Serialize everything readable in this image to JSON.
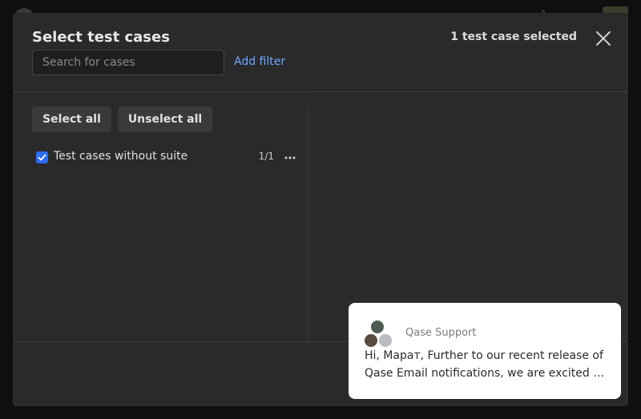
{
  "modal": {
    "title": "Select test cases",
    "selected_count": "1 test case selected",
    "search": {
      "placeholder": "Search for cases",
      "value": ""
    },
    "add_filter_label": "Add filter",
    "select_all_label": "Select all",
    "unselect_all_label": "Unselect all",
    "suites": [
      {
        "label": "Test cases without suite",
        "count": "1/1",
        "checked": true
      }
    ]
  },
  "chat": {
    "sender": "Qase Support",
    "line1": "Hi, Марат, Further to our recent release of",
    "line2": "Qase Email notifications, we are excited …"
  },
  "colors": {
    "accent": "#2d6df6",
    "link": "#6ea6ff",
    "modal_bg": "#2a2a2b",
    "page_bg": "#0f0f10"
  },
  "icons": {
    "close": "close-icon",
    "checkbox": "checkmark-icon",
    "more": "more-horizontal-icon"
  }
}
